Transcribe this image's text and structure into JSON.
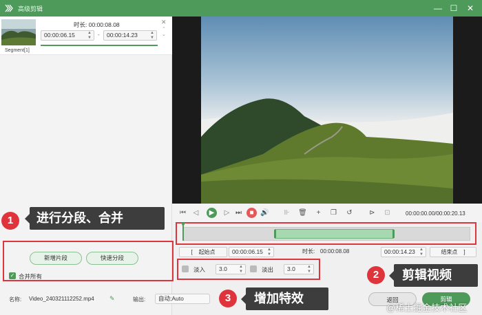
{
  "app": {
    "title": "高级剪辑"
  },
  "window_controls": {
    "minimize": "—",
    "maximize": "☐",
    "close": "✕"
  },
  "segment": {
    "label": "Segment[1]",
    "duration_label": "时长:",
    "duration_value": "00:00:08.08",
    "start_time": "00:00:06.15",
    "dash": "-",
    "end_time": "00:00:14.23",
    "progress": 1.0
  },
  "annotations": {
    "one": {
      "num": "1",
      "text": "进行分段、合并"
    },
    "two": {
      "num": "2",
      "text": "剪辑视频"
    },
    "three": {
      "num": "3",
      "text": "增加特效"
    },
    "color": "#e0343c"
  },
  "segment_actions": {
    "new_segment": "新增片段",
    "quick_split": "快速分段",
    "merge_all": "合并所有",
    "merge_all_checked": true
  },
  "player": {
    "time_display": "00:00:00.00/00:00:20.13"
  },
  "trim": {
    "start_label": "起始点",
    "start_value": "00:00:06.15",
    "duration_label": "时长:",
    "duration_value": "00:00:08.08",
    "end_value": "00:00:14.23",
    "end_label": "结束点",
    "open_bracket": "[",
    "close_bracket": "]"
  },
  "effects": {
    "fade_in_label": "淡入",
    "fade_in_value": "3.0",
    "fade_out_label": "淡出",
    "fade_out_value": "3.0"
  },
  "footer": {
    "name_label": "名称:",
    "file_name": "Video_240321112252.mp4",
    "output_label": "输出:",
    "output_value": "自动;Auto",
    "back_button": "返回",
    "export_button": "剪辑"
  },
  "watermark": "@稀土掘金技术社区",
  "colors": {
    "brand": "#4e9a5a",
    "annotation": "#e0343c",
    "callout": "#3d3d3d"
  }
}
